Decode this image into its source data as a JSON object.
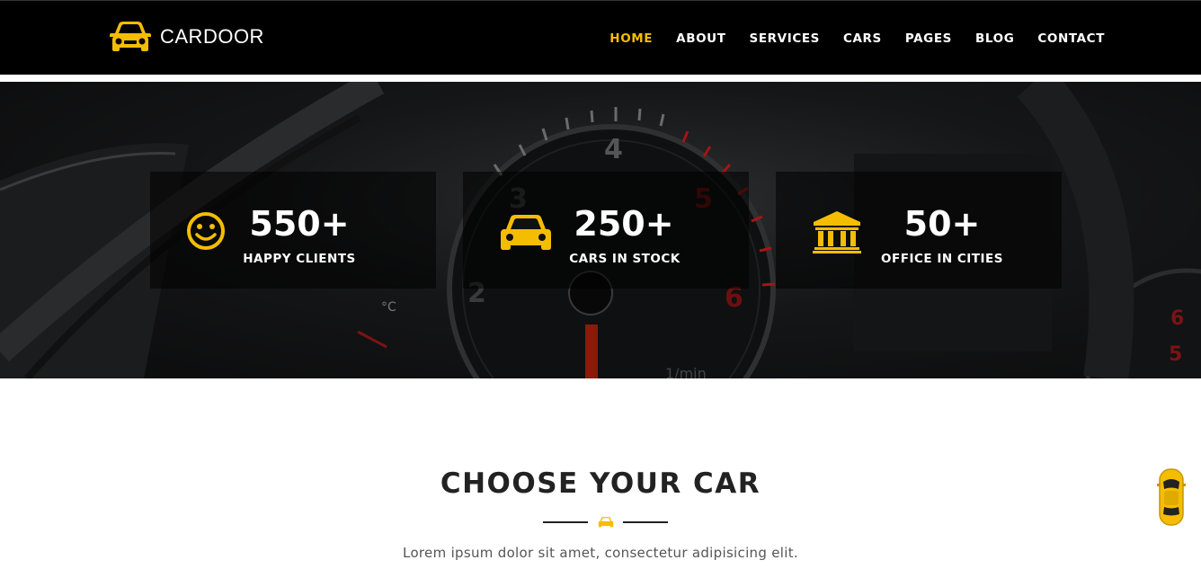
{
  "brand": {
    "name": "CARDOOR",
    "logo_icon": "car-front-icon",
    "accent_color": "#f5bd02"
  },
  "nav": {
    "items": [
      {
        "label": "HOME",
        "active": true
      },
      {
        "label": "ABOUT",
        "active": false
      },
      {
        "label": "SERVICES",
        "active": false
      },
      {
        "label": "CARS",
        "active": false
      },
      {
        "label": "PAGES",
        "active": false
      },
      {
        "label": "BLOG",
        "active": false
      },
      {
        "label": "CONTACT",
        "active": false
      }
    ]
  },
  "stats": [
    {
      "icon": "smiley-icon",
      "number": "550+",
      "label": "HAPPY CLIENTS"
    },
    {
      "icon": "car-icon",
      "number": "250+",
      "label": "CARS IN STOCK"
    },
    {
      "icon": "bank-building-icon",
      "number": "50+",
      "label": "OFFICE IN CITIES"
    }
  ],
  "section": {
    "title": "CHOOSE YOUR CAR",
    "divider_icon": "car-icon",
    "subtitle": "Lorem ipsum dolor sit amet, consectetur adipisicing elit."
  },
  "floating": {
    "icon": "top-view-car-icon"
  }
}
